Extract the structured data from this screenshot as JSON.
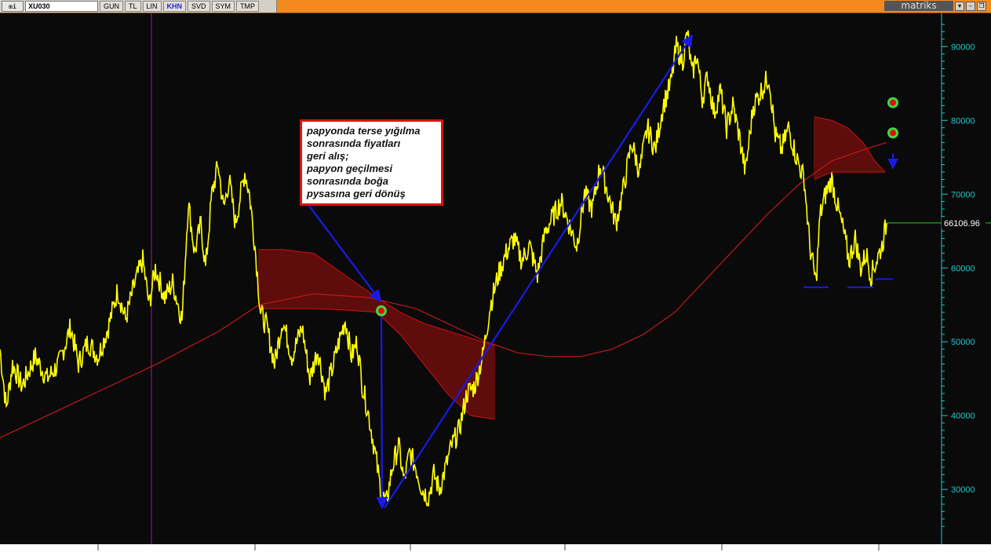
{
  "toolbar": {
    "app_icon_label": "mi",
    "symbol": "XU030",
    "buttons": [
      "GUN",
      "TL",
      "LIN",
      "KHN",
      "SVD",
      "SYM",
      "TMP"
    ],
    "active_button": "KHN",
    "brand": "matriks"
  },
  "colors": {
    "price": "#ffff00",
    "moving_average": "#c01818",
    "cloud": "#d01010",
    "trend_arrows": "#1a1ae8",
    "axis": "#22c8c8",
    "last_price_line": "#22cc22",
    "callout_border": "#e01010",
    "marker_fill": "#e01010",
    "marker_ring": "#3ddc3d"
  },
  "callout": {
    "text": "papyonda terse yığılma\nsonrasında fiyatları\ngeri alış;\npapyon geçilmesi\nsonrasında boğa\npysasına geri dönüş"
  },
  "chart_data": {
    "type": "line",
    "title": "",
    "instrument": "XU030",
    "y_axis_side": "right",
    "ylim": [
      25000,
      93000
    ],
    "y_ticks": [
      30000,
      40000,
      50000,
      60000,
      70000,
      80000,
      90000
    ],
    "y_tick_labels": [
      "30000",
      "40000",
      "50000",
      "60000",
      "70000",
      "80000",
      "90000"
    ],
    "x_tick_labels_visible": false,
    "last_price": 66106.96,
    "last_price_label": "66106.96",
    "series": [
      {
        "kind": "price",
        "x": [
          0,
          8,
          16,
          28,
          45,
          60,
          75,
          90,
          100,
          112,
          125,
          138,
          150,
          160,
          172,
          182,
          190,
          198,
          210,
          220,
          232,
          240,
          248,
          256,
          262,
          270,
          278,
          285,
          292,
          300,
          305,
          312,
          318,
          325,
          332,
          340,
          350,
          360,
          372,
          385,
          395,
          405,
          415,
          425,
          432,
          440,
          448,
          455,
          462,
          470,
          478,
          485,
          492,
          500,
          508,
          515,
          522,
          530,
          538,
          546,
          553,
          560,
          568,
          576,
          585,
          595,
          605,
          615,
          625,
          635,
          645,
          655,
          665,
          675,
          685,
          695,
          705,
          715,
          725,
          735,
          745,
          755,
          765,
          775,
          785,
          795,
          805,
          815,
          825,
          835,
          845,
          855,
          862,
          870,
          876,
          882,
          888,
          895,
          902,
          910,
          918,
          926,
          934,
          942,
          950,
          960,
          970,
          980,
          988,
          996,
          1005,
          1015,
          1025,
          1032,
          1040,
          1045,
          1052,
          1060,
          1068,
          1075,
          1082,
          1090,
          1097,
          1104,
          1110,
          1117,
          1124,
          1130
        ],
        "y": [
          49000,
          41000,
          47000,
          44000,
          48000,
          45000,
          47000,
          52000,
          47000,
          50000,
          48000,
          52000,
          57000,
          53000,
          58000,
          61000,
          55000,
          60000,
          56000,
          58000,
          53000,
          69000,
          62000,
          66000,
          60000,
          70000,
          74000,
          68000,
          72000,
          66000,
          69000,
          73000,
          70000,
          63000,
          54000,
          52000,
          47000,
          53000,
          48000,
          52000,
          45000,
          49000,
          43000,
          47000,
          50000,
          53000,
          48000,
          50000,
          44000,
          40000,
          35000,
          30000,
          28000,
          33000,
          36000,
          31000,
          35000,
          33000,
          30000,
          29000,
          32000,
          30000,
          33000,
          36000,
          38000,
          43000,
          44000,
          48000,
          55000,
          59000,
          62000,
          64000,
          61000,
          63000,
          59000,
          65000,
          67000,
          69000,
          66000,
          63000,
          70000,
          68000,
          74000,
          70000,
          66000,
          71000,
          77000,
          73000,
          79000,
          76000,
          82000,
          85000,
          90000,
          88000,
          92000,
          86000,
          89000,
          83000,
          86000,
          81000,
          84000,
          79000,
          82000,
          78000,
          73000,
          82000,
          84000,
          86000,
          78000,
          76000,
          79000,
          75000,
          72000,
          63000,
          58000,
          67000,
          70000,
          72000,
          68000,
          65000,
          61000,
          64000,
          60000,
          62000,
          59000,
          61000,
          63000,
          66107
        ]
      },
      {
        "kind": "moving_average",
        "x": [
          0,
          100,
          200,
          280,
          330,
          400,
          470,
          530,
          580,
          620,
          660,
          700,
          740,
          780,
          820,
          860,
          900,
          940,
          980,
          1020,
          1060,
          1100,
          1130
        ],
        "y": [
          37000,
          42000,
          47000,
          51500,
          55000,
          56500,
          56000,
          54500,
          52000,
          50000,
          48500,
          48000,
          48000,
          49000,
          51000,
          54000,
          58500,
          63000,
          67500,
          71500,
          74500,
          76000,
          77000
        ]
      },
      {
        "kind": "cloud_top",
        "x": [
          330,
          360,
          400,
          440,
          480,
          510,
          540,
          570,
          600,
          630
        ],
        "y": [
          62500,
          62500,
          62000,
          59000,
          56000,
          54000,
          52500,
          51500,
          50500,
          49500
        ]
      },
      {
        "kind": "cloud_bottom",
        "x": [
          330,
          360,
          400,
          440,
          480,
          510,
          540,
          570,
          600,
          630
        ],
        "y": [
          54500,
          54500,
          54500,
          54300,
          54000,
          51000,
          47000,
          43000,
          40000,
          39500
        ]
      },
      {
        "kind": "cloud2_top",
        "x": [
          1038,
          1060,
          1080,
          1100,
          1115,
          1128
        ],
        "y": [
          80500,
          80000,
          79000,
          77000,
          74500,
          73000
        ]
      },
      {
        "kind": "cloud2_bottom",
        "x": [
          1038,
          1060,
          1080,
          1100,
          1115,
          1128
        ],
        "y": [
          72000,
          73000,
          73000,
          73000,
          73000,
          73000
        ]
      }
    ],
    "arrows": [
      {
        "from": [
          390,
          69000
        ],
        "to": [
          485,
          55500
        ]
      },
      {
        "from": [
          486,
          54000
        ],
        "to": [
          487,
          27500
        ]
      },
      {
        "from": [
          490,
          27500
        ],
        "to": [
          882,
          91500
        ]
      }
    ],
    "markers": [
      {
        "x": 486,
        "y": 54200
      },
      {
        "x": 1138,
        "y": 82400
      },
      {
        "x": 1138,
        "y": 78300
      }
    ],
    "small_arrow": {
      "x": 1138,
      "y_from": 75500,
      "y_to": 73500
    },
    "support_lines": [
      {
        "x1": 1024,
        "x2": 1056,
        "y": 57400
      },
      {
        "x1": 1080,
        "x2": 1113,
        "y": 57400
      },
      {
        "x1": 1116,
        "x2": 1138,
        "y": 58500
      }
    ],
    "vertical_line_x": 193
  }
}
